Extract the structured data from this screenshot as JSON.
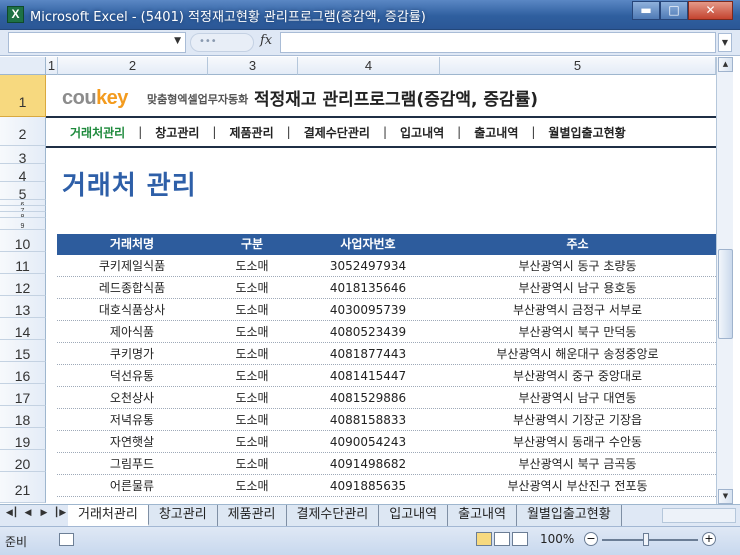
{
  "window": {
    "title": "Microsoft Excel - (5401) 적정재고현황 관리프로그램(증감액, 증감률)",
    "app_icon": "X"
  },
  "column_headers": [
    "1",
    "2",
    "3",
    "4",
    "5"
  ],
  "row_headers": [
    "1",
    "2",
    "3",
    "4",
    "5",
    "6",
    "7",
    "8",
    "9",
    "10",
    "11",
    "12",
    "13",
    "14",
    "15",
    "16",
    "17",
    "18",
    "19",
    "20",
    "21"
  ],
  "header": {
    "logo_text": "cou",
    "logo_accent": "key",
    "logo_sub": "맞춤형엑셀업무자동화",
    "title": "적정재고 관리프로그램(증감액, 증감률)"
  },
  "nav": [
    {
      "label": "거래처관리",
      "active": true
    },
    {
      "label": "창고관리"
    },
    {
      "label": "제품관리"
    },
    {
      "label": "결제수단관리"
    },
    {
      "label": "입고내역"
    },
    {
      "label": "출고내역"
    },
    {
      "label": "월별입출고현황"
    }
  ],
  "page_title": "거래처 관리",
  "table": {
    "columns": [
      "거래처명",
      "구분",
      "사업자번호",
      "주소"
    ],
    "rows": [
      [
        "쿠키제일식품",
        "도소매",
        "3052497934",
        "부산광역시 동구 초량동"
      ],
      [
        "레드종합식품",
        "도소매",
        "4018135646",
        "부산광역시 남구 용호동"
      ],
      [
        "대호식품상사",
        "도소매",
        "4030095739",
        "부산광역시 금정구 서부로"
      ],
      [
        "제아식품",
        "도소매",
        "4080523439",
        "부산광역시 북구 만덕동"
      ],
      [
        "쿠키명가",
        "도소매",
        "4081877443",
        "부산광역시 해운대구 송정중앙로"
      ],
      [
        "덕선유통",
        "도소매",
        "4081415447",
        "부산광역시 중구 중앙대로"
      ],
      [
        "오천상사",
        "도소매",
        "4081529886",
        "부산광역시 남구 대연동"
      ],
      [
        "저녁유통",
        "도소매",
        "4088158833",
        "부산광역시 기장군 기장읍"
      ],
      [
        "자연햇살",
        "도소매",
        "4090054243",
        "부산광역시 동래구 수안동"
      ],
      [
        "그림푸드",
        "도소매",
        "4091498682",
        "부산광역시 북구 금곡동"
      ],
      [
        "어른물류",
        "도소매",
        "4091885635",
        "부산광역시 부산진구 전포동"
      ]
    ]
  },
  "sheet_tabs": [
    {
      "label": "거래처관리",
      "active": true
    },
    {
      "label": "창고관리"
    },
    {
      "label": "제품관리"
    },
    {
      "label": "결제수단관리"
    },
    {
      "label": "입고내역"
    },
    {
      "label": "출고내역"
    },
    {
      "label": "월별입출고현황"
    }
  ],
  "status": {
    "ready": "준비",
    "zoom": "100%"
  },
  "colors": {
    "title_bar": "#2f5f9f",
    "table_header": "#2d5c9d",
    "page_title": "#2e5fa8",
    "nav_active": "#1e8a3c",
    "logo_accent": "#f39b1e"
  }
}
